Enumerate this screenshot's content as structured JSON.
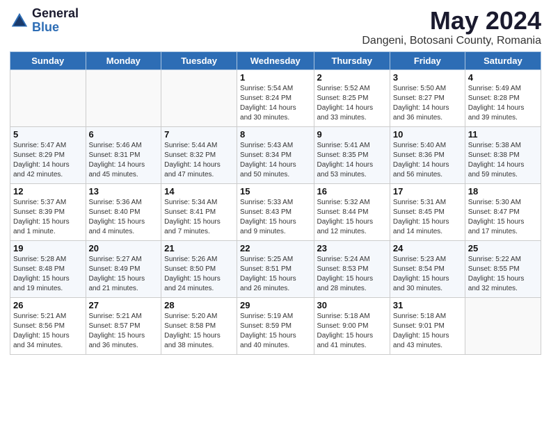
{
  "header": {
    "logo_general": "General",
    "logo_blue": "Blue",
    "title": "May 2024",
    "subtitle": "Dangeni, Botosani County, Romania"
  },
  "weekdays": [
    "Sunday",
    "Monday",
    "Tuesday",
    "Wednesday",
    "Thursday",
    "Friday",
    "Saturday"
  ],
  "weeks": [
    [
      {
        "day": "",
        "info": ""
      },
      {
        "day": "",
        "info": ""
      },
      {
        "day": "",
        "info": ""
      },
      {
        "day": "1",
        "info": "Sunrise: 5:54 AM\nSunset: 8:24 PM\nDaylight: 14 hours\nand 30 minutes."
      },
      {
        "day": "2",
        "info": "Sunrise: 5:52 AM\nSunset: 8:25 PM\nDaylight: 14 hours\nand 33 minutes."
      },
      {
        "day": "3",
        "info": "Sunrise: 5:50 AM\nSunset: 8:27 PM\nDaylight: 14 hours\nand 36 minutes."
      },
      {
        "day": "4",
        "info": "Sunrise: 5:49 AM\nSunset: 8:28 PM\nDaylight: 14 hours\nand 39 minutes."
      }
    ],
    [
      {
        "day": "5",
        "info": "Sunrise: 5:47 AM\nSunset: 8:29 PM\nDaylight: 14 hours\nand 42 minutes."
      },
      {
        "day": "6",
        "info": "Sunrise: 5:46 AM\nSunset: 8:31 PM\nDaylight: 14 hours\nand 45 minutes."
      },
      {
        "day": "7",
        "info": "Sunrise: 5:44 AM\nSunset: 8:32 PM\nDaylight: 14 hours\nand 47 minutes."
      },
      {
        "day": "8",
        "info": "Sunrise: 5:43 AM\nSunset: 8:34 PM\nDaylight: 14 hours\nand 50 minutes."
      },
      {
        "day": "9",
        "info": "Sunrise: 5:41 AM\nSunset: 8:35 PM\nDaylight: 14 hours\nand 53 minutes."
      },
      {
        "day": "10",
        "info": "Sunrise: 5:40 AM\nSunset: 8:36 PM\nDaylight: 14 hours\nand 56 minutes."
      },
      {
        "day": "11",
        "info": "Sunrise: 5:38 AM\nSunset: 8:38 PM\nDaylight: 14 hours\nand 59 minutes."
      }
    ],
    [
      {
        "day": "12",
        "info": "Sunrise: 5:37 AM\nSunset: 8:39 PM\nDaylight: 15 hours\nand 1 minute."
      },
      {
        "day": "13",
        "info": "Sunrise: 5:36 AM\nSunset: 8:40 PM\nDaylight: 15 hours\nand 4 minutes."
      },
      {
        "day": "14",
        "info": "Sunrise: 5:34 AM\nSunset: 8:41 PM\nDaylight: 15 hours\nand 7 minutes."
      },
      {
        "day": "15",
        "info": "Sunrise: 5:33 AM\nSunset: 8:43 PM\nDaylight: 15 hours\nand 9 minutes."
      },
      {
        "day": "16",
        "info": "Sunrise: 5:32 AM\nSunset: 8:44 PM\nDaylight: 15 hours\nand 12 minutes."
      },
      {
        "day": "17",
        "info": "Sunrise: 5:31 AM\nSunset: 8:45 PM\nDaylight: 15 hours\nand 14 minutes."
      },
      {
        "day": "18",
        "info": "Sunrise: 5:30 AM\nSunset: 8:47 PM\nDaylight: 15 hours\nand 17 minutes."
      }
    ],
    [
      {
        "day": "19",
        "info": "Sunrise: 5:28 AM\nSunset: 8:48 PM\nDaylight: 15 hours\nand 19 minutes."
      },
      {
        "day": "20",
        "info": "Sunrise: 5:27 AM\nSunset: 8:49 PM\nDaylight: 15 hours\nand 21 minutes."
      },
      {
        "day": "21",
        "info": "Sunrise: 5:26 AM\nSunset: 8:50 PM\nDaylight: 15 hours\nand 24 minutes."
      },
      {
        "day": "22",
        "info": "Sunrise: 5:25 AM\nSunset: 8:51 PM\nDaylight: 15 hours\nand 26 minutes."
      },
      {
        "day": "23",
        "info": "Sunrise: 5:24 AM\nSunset: 8:53 PM\nDaylight: 15 hours\nand 28 minutes."
      },
      {
        "day": "24",
        "info": "Sunrise: 5:23 AM\nSunset: 8:54 PM\nDaylight: 15 hours\nand 30 minutes."
      },
      {
        "day": "25",
        "info": "Sunrise: 5:22 AM\nSunset: 8:55 PM\nDaylight: 15 hours\nand 32 minutes."
      }
    ],
    [
      {
        "day": "26",
        "info": "Sunrise: 5:21 AM\nSunset: 8:56 PM\nDaylight: 15 hours\nand 34 minutes."
      },
      {
        "day": "27",
        "info": "Sunrise: 5:21 AM\nSunset: 8:57 PM\nDaylight: 15 hours\nand 36 minutes."
      },
      {
        "day": "28",
        "info": "Sunrise: 5:20 AM\nSunset: 8:58 PM\nDaylight: 15 hours\nand 38 minutes."
      },
      {
        "day": "29",
        "info": "Sunrise: 5:19 AM\nSunset: 8:59 PM\nDaylight: 15 hours\nand 40 minutes."
      },
      {
        "day": "30",
        "info": "Sunrise: 5:18 AM\nSunset: 9:00 PM\nDaylight: 15 hours\nand 41 minutes."
      },
      {
        "day": "31",
        "info": "Sunrise: 5:18 AM\nSunset: 9:01 PM\nDaylight: 15 hours\nand 43 minutes."
      },
      {
        "day": "",
        "info": ""
      }
    ]
  ]
}
